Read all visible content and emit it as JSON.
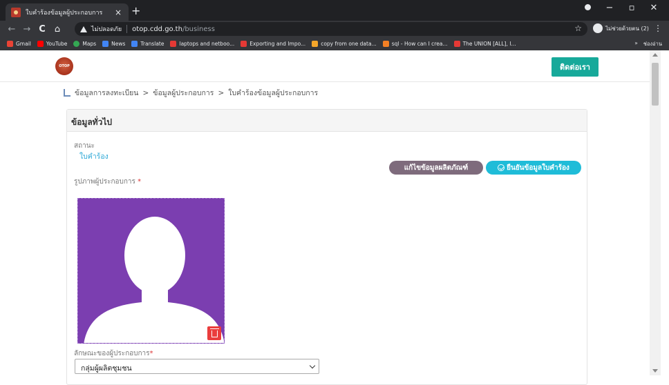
{
  "browser": {
    "tab_title": "ใบคำร้องข้อมูลผู้ประกอบการ",
    "tab_close": "×",
    "new_tab": "+",
    "win_min": "−",
    "win_restore": "▫",
    "win_close": "✕",
    "back": "←",
    "forward": "→",
    "reload": "C",
    "home": "⌂",
    "insecure_label": "ไม่ปลอดภัย",
    "url_host": "otop.cdd.go.th",
    "url_path": "/business",
    "star": "☆",
    "profile_label": "ไม่ช่วยด้วยตน (2)",
    "menu": "⋮"
  },
  "bookmarks": [
    {
      "label": "Gmail",
      "color": "#ea4335"
    },
    {
      "label": "YouTube",
      "color": "#ff0000"
    },
    {
      "label": "Maps",
      "color": "#34a853"
    },
    {
      "label": "News",
      "color": "#4285f4"
    },
    {
      "label": "Translate",
      "color": "#4285f4"
    },
    {
      "label": "laptops and netboo...",
      "color": "#e53935"
    },
    {
      "label": "Exporting and Impo...",
      "color": "#e53935"
    },
    {
      "label": "copy from one data...",
      "color": "#f4a62a"
    },
    {
      "label": "sql - How can I crea...",
      "color": "#f48024"
    },
    {
      "label": "The UNION [ALL], I...",
      "color": "#e53935"
    }
  ],
  "bookmarks_more": "»",
  "bookmarks_reading": "ช่องอ่าน",
  "header": {
    "logo_text": "OTOP",
    "contact_label": "ติดต่อเรา"
  },
  "breadcrumb": {
    "item1": "ข้อมูลการลงทะเบียน",
    "sep1": ">",
    "item2": "ข้อมูลผู้ประกอบการ",
    "sep2": ">",
    "item3": "ใบคำร้องข้อมูลผู้ประกอบการ"
  },
  "card": {
    "title": "ข้อมูลทั่วไป",
    "status_label": "สถานะ",
    "status_value": "ใบคำร้อง",
    "edit_button": "แก้ไขข้อมูลผลิตภัณฑ์",
    "confirm_button": "ยืนยันข้อมูลใบคำร้อง",
    "photo_label": "รูปภาพผู้ประกอบการ",
    "required_mark": "*",
    "type_label": "ลักษณะของผู้ประกอบการ",
    "type_value": "กลุ่มผู้ผลิตชุมชน"
  },
  "colors": {
    "teal_button": "#17a99a",
    "edit_button": "#7e6b7c",
    "confirm_button": "#1fbcd8",
    "photo_bg": "#7b3eb0",
    "trash": "#ea3d3d"
  }
}
